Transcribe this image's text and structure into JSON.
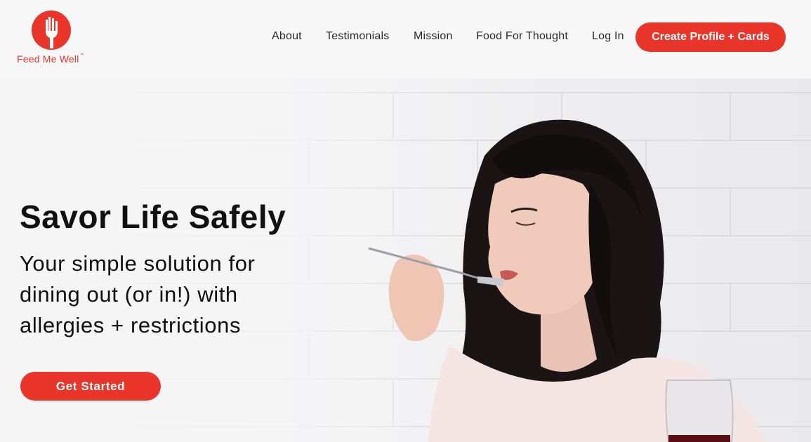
{
  "brand": {
    "name": "Feed Me Well",
    "trademark": "™",
    "logo_icon": "hand-fork-icon",
    "accent_color": "#ea352b"
  },
  "nav": {
    "items": [
      {
        "label": "About"
      },
      {
        "label": "Testimonials"
      },
      {
        "label": "Mission"
      },
      {
        "label": "Food For Thought"
      },
      {
        "label": "Log In"
      }
    ],
    "cta_label": "Create Profile + Cards"
  },
  "hero": {
    "title": "Savor Life Safely",
    "subtitle": "Your simple solution for dining out (or in!) with allergies + restrictions",
    "cta_label": "Get Started",
    "image": "woman-eating-pasta-photo"
  }
}
